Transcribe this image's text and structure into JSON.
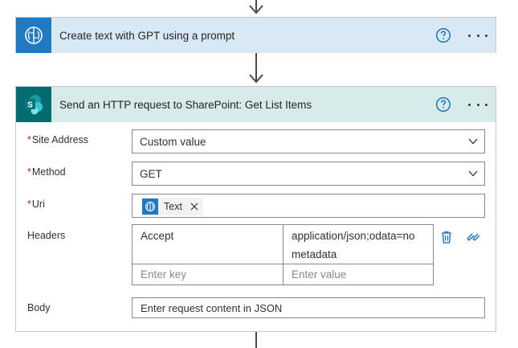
{
  "steps": {
    "gpt_step": {
      "title": "Create text with GPT using a prompt",
      "icon": "gpt-brain-icon",
      "header_color": "#d9e8f5",
      "icon_bg": "#1f7ac2"
    },
    "sharepoint_step": {
      "title": "Send an HTTP request to SharePoint: Get List Items",
      "icon": "sharepoint-icon",
      "header_color": "#d7ebea",
      "icon_bg": "#036c70"
    }
  },
  "form": {
    "site_address": {
      "label": "Site Address",
      "required_mark": "*",
      "value": "Custom value"
    },
    "method": {
      "label": "Method",
      "required_mark": "*",
      "value": "GET"
    },
    "uri": {
      "label": "Uri",
      "required_mark": "*",
      "token_label": "Text"
    },
    "headers": {
      "label": "Headers",
      "rows": [
        {
          "key": "Accept",
          "value_line1": "application/json;odata=no",
          "value_line2": "metadata"
        }
      ],
      "key_placeholder": "Enter key",
      "value_placeholder": "Enter value"
    },
    "body": {
      "label": "Body",
      "placeholder": "Enter request content in JSON"
    }
  },
  "colors": {
    "accent_blue": "#0f6cbd",
    "required_red": "#a4262c"
  }
}
